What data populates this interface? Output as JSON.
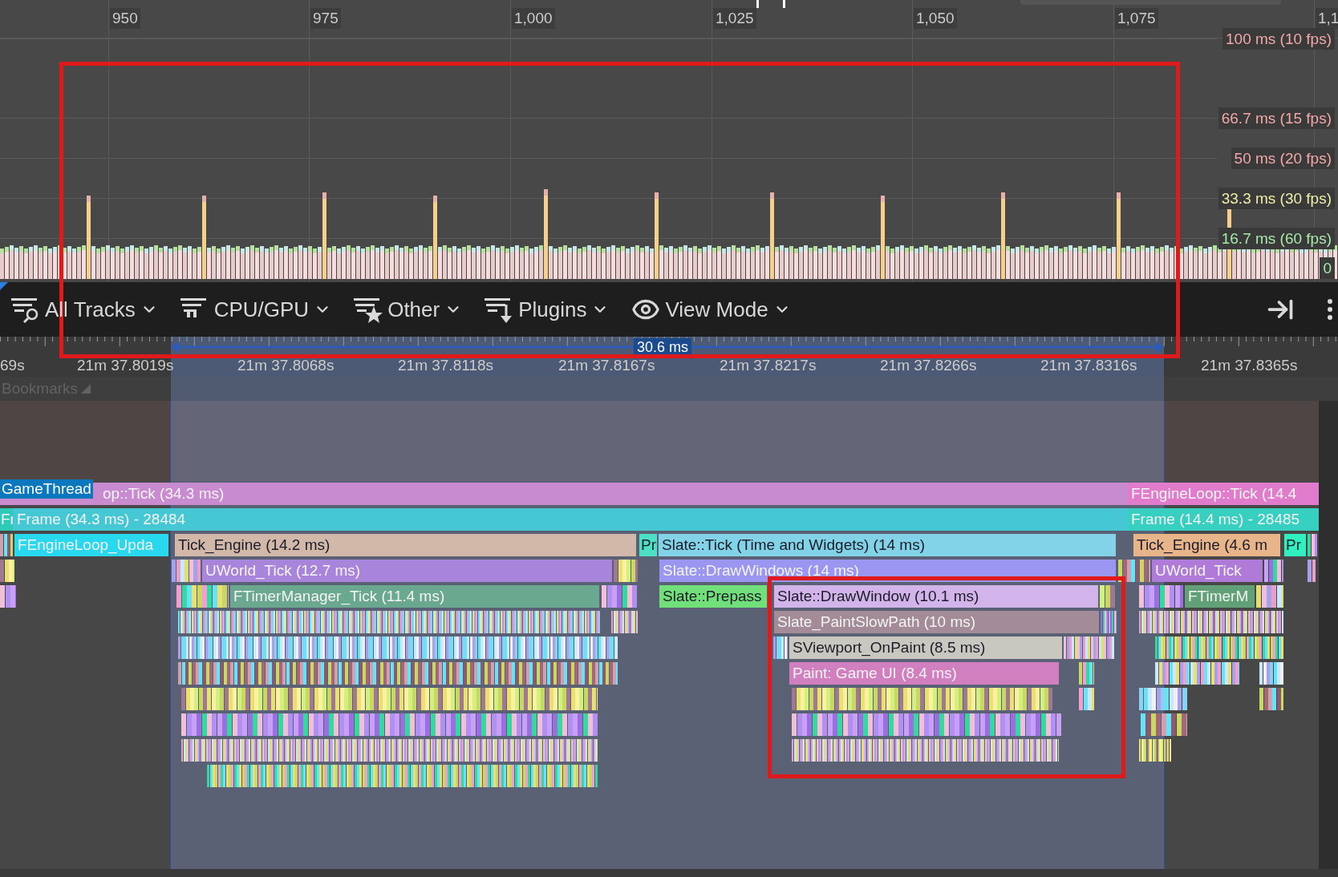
{
  "frames_graph": {
    "axis_labels": [
      "950",
      "975",
      "1,000",
      "1,025",
      "1,050",
      "1,075",
      "1,1"
    ],
    "thresholds": [
      {
        "label": "100 ms (10 fps)",
        "color": "#f2a8a8"
      },
      {
        "label": "66.7 ms (15 fps)",
        "color": "#f2a8a8"
      },
      {
        "label": "50 ms (20 fps)",
        "color": "#f2a8a8"
      },
      {
        "label": "33.3 ms (30 fps)",
        "color": "#eeeeaa"
      },
      {
        "label": "16.7 ms (60 fps)",
        "color": "#a8e8a8"
      },
      {
        "label": "0",
        "color": "#a8e8a8"
      }
    ]
  },
  "toolbar": {
    "menus": [
      {
        "label": "All Tracks",
        "kind": "tracks"
      },
      {
        "label": "CPU/GPU",
        "kind": "cpu"
      },
      {
        "label": "Other",
        "kind": "other"
      },
      {
        "label": "Plugins",
        "kind": "plugins"
      },
      {
        "label": "View Mode",
        "kind": "view"
      }
    ]
  },
  "timeline": {
    "time_labels": [
      "69s",
      "21m 37.8019s",
      "21m 37.8068s",
      "21m 37.8118s",
      "21m 37.8167s",
      "21m 37.8217s",
      "21m 37.8266s",
      "21m 37.8316s",
      "21m 37.8365s"
    ],
    "selection": "30.6 ms",
    "bookmarks": "Bookmarks"
  },
  "track": {
    "name": "GameThread",
    "events": [
      {
        "label": "op::Tick (34.3 ms)",
        "color": "#c98bd0"
      },
      {
        "label": "FEngineLoop::Tick (14.4",
        "color": "#e07ccb"
      },
      {
        "label": "Fr",
        "color": "#2fc9b8"
      },
      {
        "label": "Frame (34.3 ms) -  28484",
        "color": "#45c8d3"
      },
      {
        "label": "Frame (14.4 ms) -  28485",
        "color": "#36cfc0"
      },
      {
        "label": "FEngineLoop_Upda",
        "color": "#29d8ee"
      },
      {
        "label": "Tick_Engine (14.2 ms)",
        "color": "#d2b8a8"
      },
      {
        "label": "Pr",
        "color": "#4ee0c6"
      },
      {
        "label": "Slate::Tick (Time and Widgets) (14 ms)",
        "color": "#82d3e8"
      },
      {
        "label": "Tick_Engine (4.6 m",
        "color": "#e8b48a"
      },
      {
        "label": "Pr",
        "color": "#30f0c0"
      },
      {
        "label": "UWorld_Tick (12.7 ms)",
        "color": "#a984db"
      },
      {
        "label": "Slate::DrawWindows (14 ms)",
        "color": "#9a96f2"
      },
      {
        "label": "UWorld_Tick",
        "color": "#b07ad8"
      },
      {
        "label": "FTimerManager_Tick (11.4 ms)",
        "color": "#6aa88f"
      },
      {
        "label": "Slate::Prepass",
        "color": "#72e07a"
      },
      {
        "label": "Slate::DrawWindow (10.1 ms)",
        "color": "#d2b4ea"
      },
      {
        "label": "FTimerM",
        "color": "#62a078"
      },
      {
        "label": "Slate_PaintSlowPath (10 ms)",
        "color": "#a38c98"
      },
      {
        "label": "SViewport_OnPaint (8.5 ms)",
        "color": "#c8c8c0"
      },
      {
        "label": "Paint: Game UI (8.4 ms)",
        "color": "#d27fc0"
      }
    ]
  }
}
